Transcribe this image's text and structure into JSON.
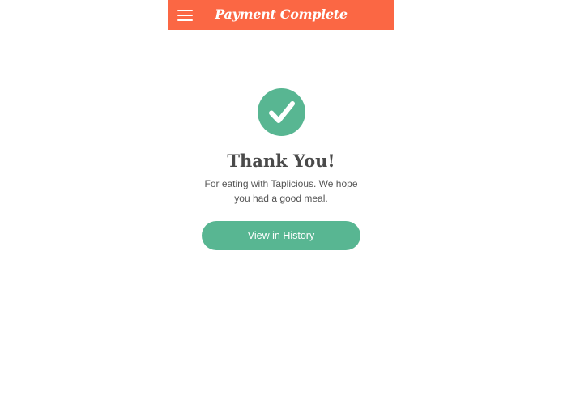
{
  "header": {
    "menu_icon": "hamburger-menu-icon",
    "title": "Payment Complete",
    "background_color": "#fb6744"
  },
  "confirmation": {
    "icon": "checkmark-circle-icon",
    "accent_color": "#58b692",
    "heading": "Thank You!",
    "message": "For eating with Taplicious. We hope you had a good meal.",
    "history_button_label": "View in History"
  }
}
